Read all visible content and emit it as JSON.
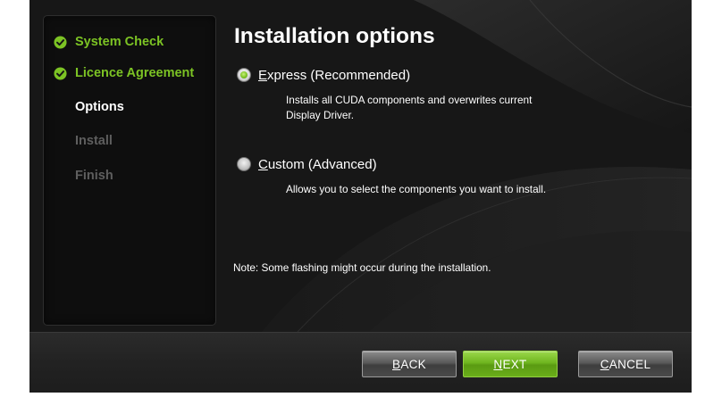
{
  "sidebar": {
    "steps": [
      {
        "label": "System Check",
        "state": "done"
      },
      {
        "label": "Licence Agreement",
        "state": "done"
      },
      {
        "label": "Options",
        "state": "current"
      },
      {
        "label": "Install",
        "state": "pending"
      },
      {
        "label": "Finish",
        "state": "pending"
      }
    ]
  },
  "main": {
    "title": "Installation options",
    "options": [
      {
        "mnemonic": "E",
        "label_rest": "xpress (Recommended)",
        "selected": true,
        "description_line1": "Installs all CUDA components and overwrites current",
        "description_line2": "Display Driver."
      },
      {
        "mnemonic": "C",
        "label_rest": "ustom (Advanced)",
        "selected": false,
        "description_line1": "Allows you to select the components you want to install.",
        "description_line2": ""
      }
    ],
    "note": "Note: Some flashing might occur during the installation."
  },
  "footer": {
    "back": {
      "mnemonic": "B",
      "rest": "ACK"
    },
    "next": {
      "mnemonic": "N",
      "rest": "EXT"
    },
    "cancel": {
      "mnemonic": "C",
      "rest": "ANCEL"
    }
  },
  "colors": {
    "accent_green": "#7cc324",
    "window_bg": "#151515",
    "pending_text": "#5e5e5e"
  },
  "icons": {
    "done_step": "check-circle-icon"
  }
}
